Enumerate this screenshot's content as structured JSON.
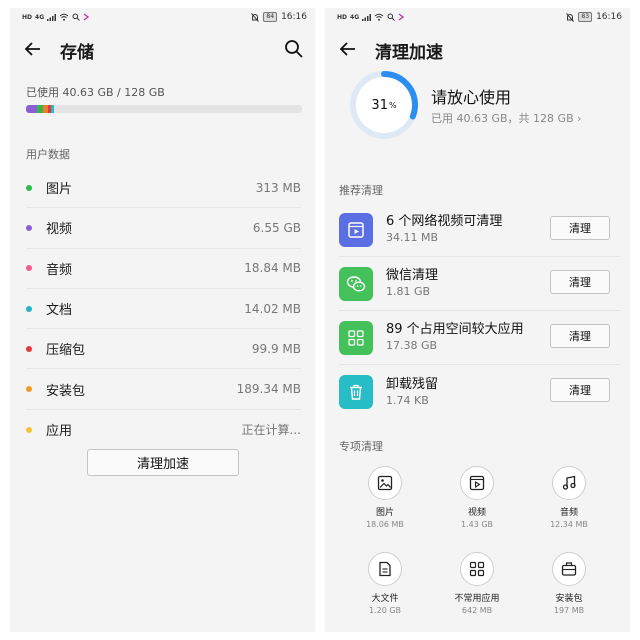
{
  "status_left": {
    "net": "HD",
    "sig": "4G"
  },
  "status_right": {
    "left_battery": "84",
    "right_battery": "83",
    "time": "16:16"
  },
  "storage": {
    "title": "存储",
    "usage_text": "已使用 40.63 GB / 128 GB",
    "section_label": "用户数据",
    "bar_segments": [
      {
        "color": "#8a5fd4",
        "fraction": 0.04
      },
      {
        "color": "#3ab54a",
        "fraction": 0.02
      },
      {
        "color": "#ee7f2d",
        "fraction": 0.02
      },
      {
        "color": "#e33838",
        "fraction": 0.01
      },
      {
        "color": "#27b6cf",
        "fraction": 0.01
      }
    ],
    "categories": [
      {
        "name": "图片",
        "size": "313 MB",
        "color": "#2bbb49"
      },
      {
        "name": "视频",
        "size": "6.55 GB",
        "color": "#8a5fd4"
      },
      {
        "name": "音频",
        "size": "18.84 MB",
        "color": "#ef5d8c"
      },
      {
        "name": "文档",
        "size": "14.02 MB",
        "color": "#21b6c9"
      },
      {
        "name": "压缩包",
        "size": "99.9 MB",
        "color": "#e53a3a"
      },
      {
        "name": "安装包",
        "size": "189.34 MB",
        "color": "#f29a22"
      },
      {
        "name": "应用",
        "size": "正在计算...",
        "color": "#f4c23a"
      }
    ],
    "clean_button": "清理加速"
  },
  "cleaner": {
    "title": "清理加速",
    "percent": "31",
    "percent_unit": "%",
    "percent_value": 0.31,
    "summary_title": "请放心使用",
    "summary_sub": "已用 40.63 GB，共 128 GB ›",
    "recommend_label": "推荐清理",
    "recommendations": [
      {
        "title": "6 个网络视频可清理",
        "size": "34.11 MB",
        "button": "清理",
        "color": "#5b6fe3",
        "icon": "video-icon"
      },
      {
        "title": "微信清理",
        "size": "1.81 GB",
        "button": "清理",
        "color": "#45c15b",
        "icon": "wechat-icon"
      },
      {
        "title": "89 个占用空间较大应用",
        "size": "17.38 GB",
        "button": "清理",
        "color": "#45c15b",
        "icon": "apps-grid-icon"
      },
      {
        "title": "卸载残留",
        "size": "1.74 KB",
        "button": "清理",
        "color": "#28bcc7",
        "icon": "trash-icon"
      }
    ],
    "special_label": "专项清理",
    "special_items": [
      {
        "label": "图片",
        "size": "18.06 MB",
        "icon": "image-icon"
      },
      {
        "label": "视频",
        "size": "1.43 GB",
        "icon": "video-icon"
      },
      {
        "label": "音频",
        "size": "12.34 MB",
        "icon": "music-icon"
      },
      {
        "label": "大文件",
        "size": "1.20 GB",
        "icon": "file-icon"
      },
      {
        "label": "不常用应用",
        "size": "642 MB",
        "icon": "apps-grid-icon"
      },
      {
        "label": "安装包",
        "size": "197 MB",
        "icon": "package-icon"
      }
    ]
  },
  "accent_color": "#2d8ef2"
}
